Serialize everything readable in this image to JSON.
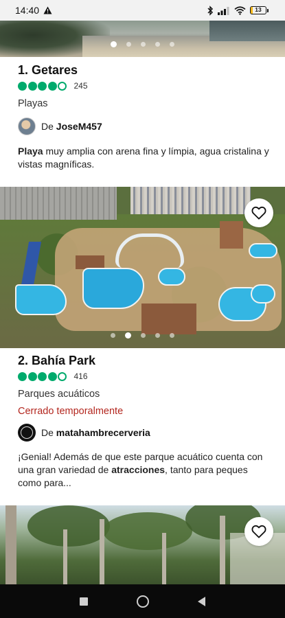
{
  "status_bar": {
    "time": "14:40",
    "battery_level": "13",
    "battery_fraction": 0.13
  },
  "colors": {
    "rating_bubble": "#00aa6c",
    "closed_status": "#b3261e"
  },
  "cards": [
    {
      "title": "1. Getares",
      "rating_bubbles": 4,
      "review_count": "245",
      "category": "Playas",
      "reviewer_prefix": "De",
      "reviewer_name": "JoseM457",
      "snippet_bold": "Playa",
      "snippet_rest": " muy amplia con arena fina y límpia, agua cristalina y vistas magníficas.",
      "photo_dots": 5,
      "active_dot": 0
    },
    {
      "title": "2. Bahía Park",
      "rating_bubbles": 4,
      "review_count": "416",
      "category": "Parques acuáticos",
      "status": "Cerrado temporalmente",
      "reviewer_prefix": "De",
      "reviewer_name": "matahambrecerveria",
      "snippet_pre": "¡Genial! Además de que este parque acuático cuenta con una gran variedad de ",
      "snippet_bold": "atracciones",
      "snippet_post": ", tanto para peques como para...",
      "photo_dots": 5,
      "active_dot": 1
    }
  ],
  "icons": {
    "save": "heart-outline-icon",
    "warning": "warning-icon",
    "bluetooth": "bluetooth-icon",
    "signal": "signal-icon",
    "wifi": "wifi-icon",
    "nav_recents": "square-icon",
    "nav_home": "circle-icon",
    "nav_back": "triangle-back-icon"
  }
}
